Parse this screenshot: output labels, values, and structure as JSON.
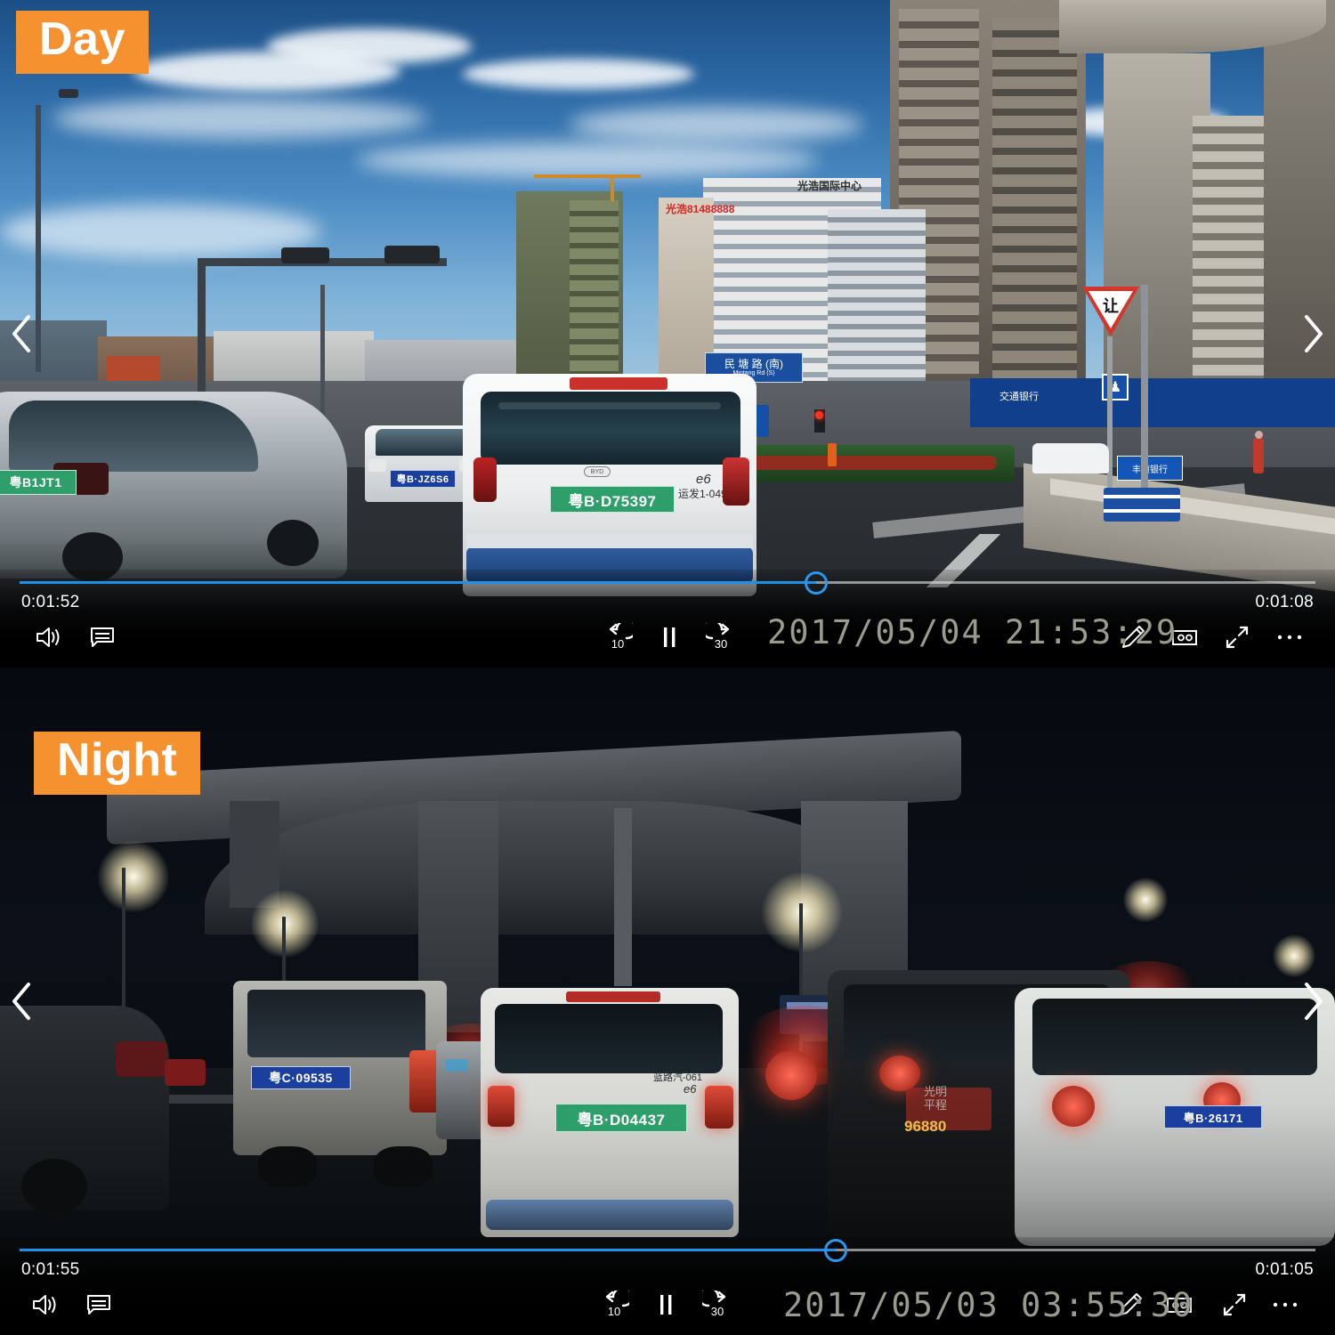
{
  "app": {
    "kind": "video-player-comparison",
    "accent_blue": "#1e90e8",
    "badge_color": "#f5912e"
  },
  "panels": [
    {
      "id": "day",
      "badge": "Day",
      "osd_timestamp": "2017/05/04  21:53:29",
      "progress": {
        "elapsed": "0:01:52",
        "remaining": "0:01:08",
        "percent": 62
      },
      "controls": {
        "volume": "volume-icon",
        "subtitles": "subtitles-icon",
        "rewind_label": "10",
        "play_state": "pause",
        "forward_label": "30",
        "edit": "pencil-icon",
        "clip": "video-clip-icon",
        "compress": "exit-fullscreen-icon",
        "more": "more-icon"
      },
      "nav": {
        "prev": "chevron-left-icon",
        "next": "chevron-right-icon"
      },
      "scene_text": {
        "license_plate_lead_car": "粤B·D75397",
        "license_plate_left_car": "粤B1JT1",
        "license_plate_white_car": "粤B·JZ6S6",
        "car_model_badge": "e6",
        "fleet_number": "运发1-049",
        "road_sign_cn": "民 塘 路 (南)",
        "road_sign_en": "Mintang  Rd  (S)",
        "yield_sign": "让",
        "building_sign_1": "光浩81488888",
        "building_sign_2": "光浩国际中心",
        "bank_sign": "交通银行",
        "shop_sign": "丰硕银行"
      }
    },
    {
      "id": "night",
      "badge": "Night",
      "osd_timestamp": "2017/05/03  03:55:30",
      "progress": {
        "elapsed": "0:01:55",
        "remaining": "0:01:05",
        "percent": 63
      },
      "controls": {
        "volume": "volume-icon",
        "subtitles": "subtitles-icon",
        "rewind_label": "10",
        "play_state": "pause",
        "forward_label": "30",
        "edit": "pencil-icon",
        "clip": "video-clip-icon",
        "compress": "exit-fullscreen-icon",
        "more": "more-icon"
      },
      "nav": {
        "prev": "chevron-left-icon",
        "next": "chevron-right-icon"
      },
      "scene_text": {
        "license_plate_lead_car": "粤B·D04437",
        "license_plate_van": "粤C·09535",
        "license_plate_right_car": "粤B·26171",
        "car_model_badge": "e6",
        "fleet_number": "蓝路汽-061",
        "ad_phone": "96880",
        "side_text": "光明\n平程"
      }
    }
  ]
}
